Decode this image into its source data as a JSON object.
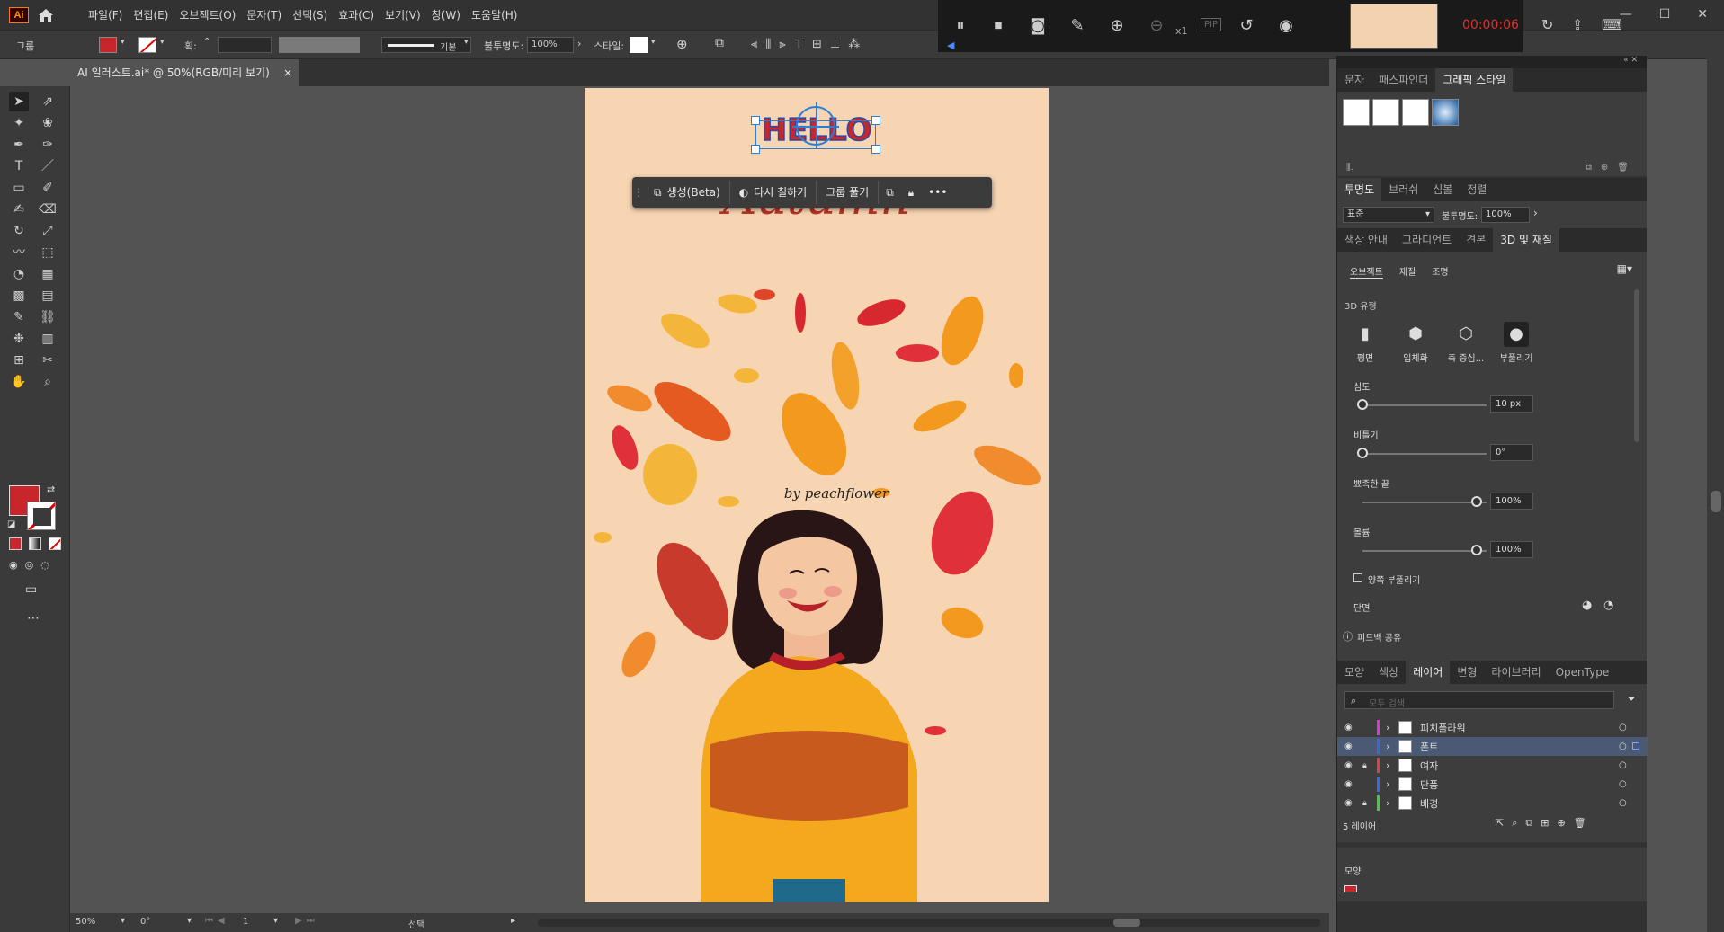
{
  "app": {
    "logo": "Ai"
  },
  "menu": [
    "파일(F)",
    "편집(E)",
    "오브젝트(O)",
    "문자(T)",
    "선택(S)",
    "효과(C)",
    "보기(V)",
    "창(W)",
    "도움말(H)"
  ],
  "window_controls": [
    "—",
    "☐",
    "✕"
  ],
  "control_bar": {
    "selection_label": "그룹",
    "stroke_label": "획:",
    "stroke_profile": "기본",
    "opacity_label": "불투명도:",
    "opacity_value": "100%",
    "style_label": "스타일:"
  },
  "document_tab": {
    "title": "AI 일러스트.ai* @ 50%(RGB/미리 보기)",
    "close": "×"
  },
  "recorder": {
    "time": "00:00:06",
    "zoom": "x1",
    "pip": "PIP"
  },
  "artboard": {
    "hello": "HELLO",
    "script_title": "Autumn",
    "credit": "by peachflower"
  },
  "context_toolbar": {
    "generate": "생성(Beta)",
    "recolor": "다시 칠하기",
    "ungroup": "그룹 풀기",
    "more": "•••"
  },
  "graphic_styles_panel": {
    "tabs": [
      "문자",
      "패스파인더",
      "그래픽 스타일"
    ],
    "active": "그래픽 스타일"
  },
  "transparency_panel": {
    "tabs": [
      "투명도",
      "브러쉬",
      "심볼",
      "정렬"
    ],
    "blend_mode": "표준",
    "opacity_label": "불투명도:",
    "opacity_value": "100%"
  },
  "threed_panel": {
    "tabs": [
      "색상 안내",
      "그라디언트",
      "견본",
      "3D 및 재질"
    ],
    "subtabs": [
      "오브젝트",
      "재질",
      "조명"
    ],
    "type_label": "3D 유형",
    "types": [
      "평면",
      "입체화",
      "축 중심...",
      "부풀리기"
    ],
    "depth_label": "심도",
    "depth_value": "10 px",
    "twist_label": "비틀기",
    "twist_value": "0°",
    "taper_label": "뾰족한 끝",
    "taper_value": "100%",
    "volume_label": "볼륨",
    "volume_value": "100%",
    "both_sides": "양쪽 부풀리기",
    "cap_label": "단면",
    "feedback": "피드백 공유"
  },
  "layers_panel": {
    "tabs": [
      "모양",
      "색상",
      "레이어",
      "변형",
      "라이브러리",
      "OpenType"
    ],
    "active": "레이어",
    "search_placeholder": "모두 검색",
    "layers": [
      {
        "name": "피치플라워",
        "color": "#d93ad6",
        "locked": false,
        "selected": false
      },
      {
        "name": "폰트",
        "color": "#3a66e0",
        "locked": false,
        "selected": true
      },
      {
        "name": "여자",
        "color": "#e04040",
        "locked": true,
        "selected": false
      },
      {
        "name": "단풍",
        "color": "#3a66e0",
        "locked": false,
        "selected": false
      },
      {
        "name": "배경",
        "color": "#3ad13a",
        "locked": true,
        "selected": false
      }
    ],
    "count": "5 레이어"
  },
  "appearance_panel": {
    "title": "모양"
  },
  "status_bar": {
    "zoom": "50%",
    "rotation": "0°",
    "artboard_no": "1",
    "tool": "선택"
  },
  "colors": {
    "fill": "#c9262c",
    "artboard_bg": "#f7d5b3",
    "accent": "#2a7fd4"
  }
}
